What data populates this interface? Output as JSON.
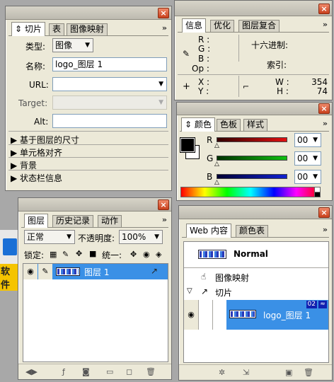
{
  "slice_panel": {
    "tabs": [
      "切片",
      "表",
      "图像映射"
    ],
    "type_label": "类型:",
    "type_value": "图像",
    "name_label": "名称:",
    "name_value": "logo_图层 1",
    "url_label": "URL:",
    "url_value": "",
    "target_label": "Target:",
    "target_value": "",
    "alt_label": "Alt:",
    "alt_value": "",
    "sections": [
      "基于图层的尺寸",
      "单元格对齐",
      "背景",
      "状态栏信息"
    ]
  },
  "info_panel": {
    "tabs": [
      "信息",
      "优化",
      "图层复合"
    ],
    "r": "R :",
    "g": "G :",
    "b": "B :",
    "op": "Op :",
    "hex_label": "十六进制:",
    "index_label": "索引:",
    "x": "X :",
    "y": "Y :",
    "w_label": "W :",
    "h_label": "H :",
    "w_value": "354",
    "h_value": "74"
  },
  "color_panel": {
    "tabs": [
      "颜色",
      "色板",
      "样式"
    ],
    "r_label": "R",
    "g_label": "G",
    "b_label": "B",
    "r_value": "00",
    "g_value": "00",
    "b_value": "00",
    "colors": {
      "r": "#e01010",
      "g": "#10c010",
      "b": "#1020d0"
    }
  },
  "layers_panel": {
    "tabs": [
      "图层",
      "历史记录",
      "动作"
    ],
    "blend_mode": "正常",
    "opacity_label": "不透明度:",
    "opacity_value": "100%",
    "lock_label": "锁定:",
    "unify_label": "统一:",
    "layer_name": "图层 1"
  },
  "web_panel": {
    "tabs": [
      "Web 内容",
      "颜色表"
    ],
    "normal_label": "Normal",
    "imagemap_label": "图像映射",
    "slices_label": "切片",
    "slice_name": "logo_图层 1",
    "slice_badge": "02"
  },
  "background": {
    "left_text": "软件"
  }
}
